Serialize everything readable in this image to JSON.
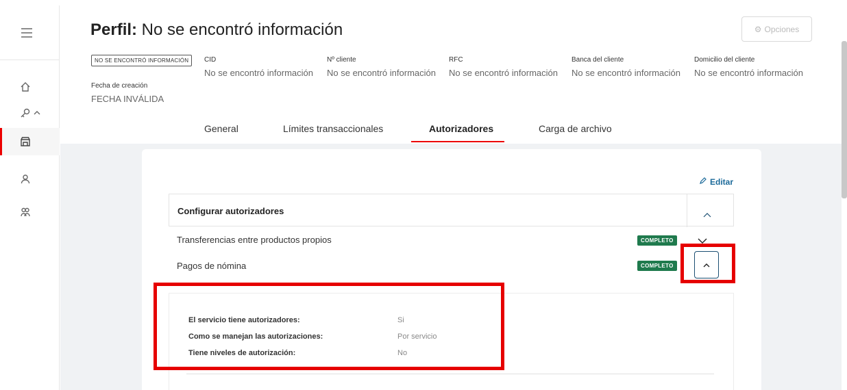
{
  "header": {
    "title_bold": "Perfil:",
    "title_rest": " No se encontró información",
    "options_label": "Opciones",
    "status_badge": "NO SE ENCONTRÓ INFORMACIÓN",
    "fields": [
      {
        "label": "CID",
        "value": "No se encontró información"
      },
      {
        "label": "Nº cliente",
        "value": "No se encontró información"
      },
      {
        "label": "RFC",
        "value": "No se encontró información"
      },
      {
        "label": "Banca del cliente",
        "value": "No se encontró información"
      },
      {
        "label": "Domicilio del cliente",
        "value": "No se encontró información"
      }
    ],
    "created_label": "Fecha de creación",
    "created_value": "FECHA INVÁLIDA"
  },
  "tabs": [
    "General",
    "Límites transaccionales",
    "Autorizadores",
    "Carga de archivo"
  ],
  "active_tab": "Autorizadores",
  "sidebar": {
    "icons": [
      "menu-icon",
      "home-icon",
      "key-icon",
      "store-icon",
      "user-icon",
      "users-icon"
    ]
  },
  "content": {
    "edit_label": "Editar",
    "section_title": "Configurar autorizadores",
    "rows": [
      {
        "label": "Transferencias entre productos propios",
        "status": "COMPLETO"
      },
      {
        "label": "Pagos de nómina",
        "status": "COMPLETO"
      }
    ],
    "details": [
      {
        "label": "El servicio tiene autorizadores:",
        "value": "Si"
      },
      {
        "label": "Como se manejan las autorizaciones:",
        "value": "Por servicio"
      },
      {
        "label": "Tiene niveles de autorización:",
        "value": "No"
      }
    ]
  },
  "colors": {
    "accent": "#ec0000",
    "link": "#1b6a9a",
    "success": "#1f7a4d",
    "highlight": "#e60000"
  }
}
